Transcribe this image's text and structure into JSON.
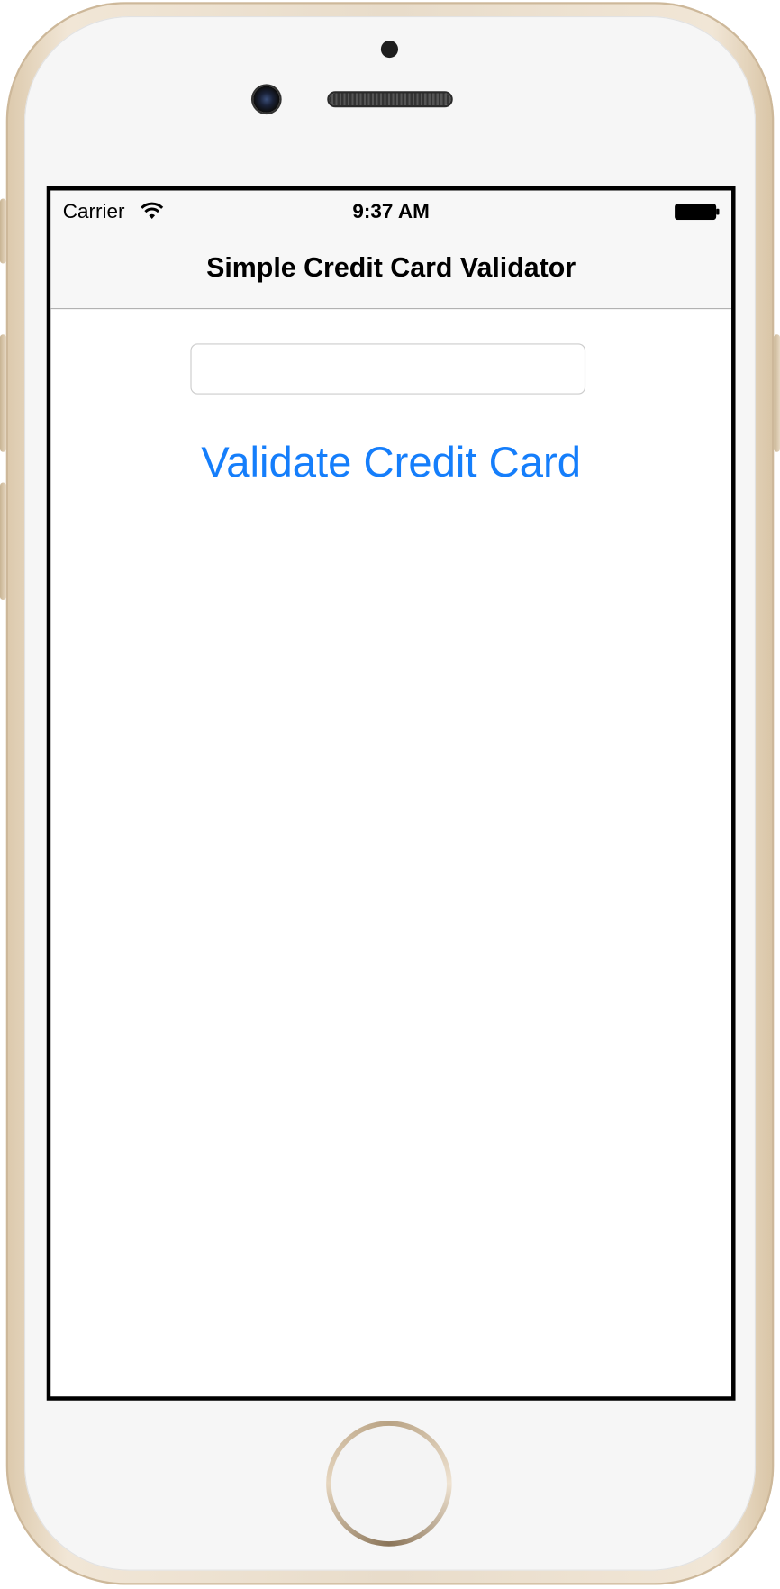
{
  "status_bar": {
    "carrier": "Carrier",
    "time": "9:37 AM"
  },
  "nav_bar": {
    "title": "Simple Credit Card Validator"
  },
  "card_input": {
    "value": "",
    "placeholder": ""
  },
  "validate_button": {
    "label": "Validate Credit Card"
  },
  "colors": {
    "accent": "#157efb",
    "nav_background": "#f7f7f7",
    "device_frame": "#e8dcca"
  },
  "icons": [
    "wifi-icon",
    "battery-icon"
  ]
}
